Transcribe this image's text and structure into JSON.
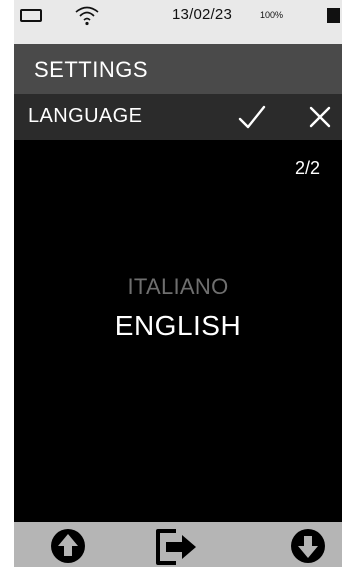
{
  "status_bar": {
    "date": "13/02/23",
    "battery_percent": "100%"
  },
  "header": {
    "title": "SETTINGS"
  },
  "subheader": {
    "title": "LANGUAGE"
  },
  "page_indicator": "2/2",
  "languages": {
    "options": [
      "ITALIANO",
      "ENGLISH"
    ],
    "selected": "ENGLISH"
  },
  "icons": {
    "battery": "battery-outline-icon",
    "wifi": "wifi-icon",
    "confirm": "checkmark-icon",
    "cancel": "close-icon",
    "up": "arrow-up-circle-icon",
    "exit": "exit-icon",
    "down": "arrow-down-circle-icon"
  },
  "colors": {
    "background": "#000000",
    "header": "#4a4a4a",
    "subheader": "#2b2b2b",
    "statusbar": "#e9e9e9",
    "bottombar": "#b5b5b5",
    "inactive_option": "#6f6f6f",
    "active_option": "#ffffff"
  }
}
